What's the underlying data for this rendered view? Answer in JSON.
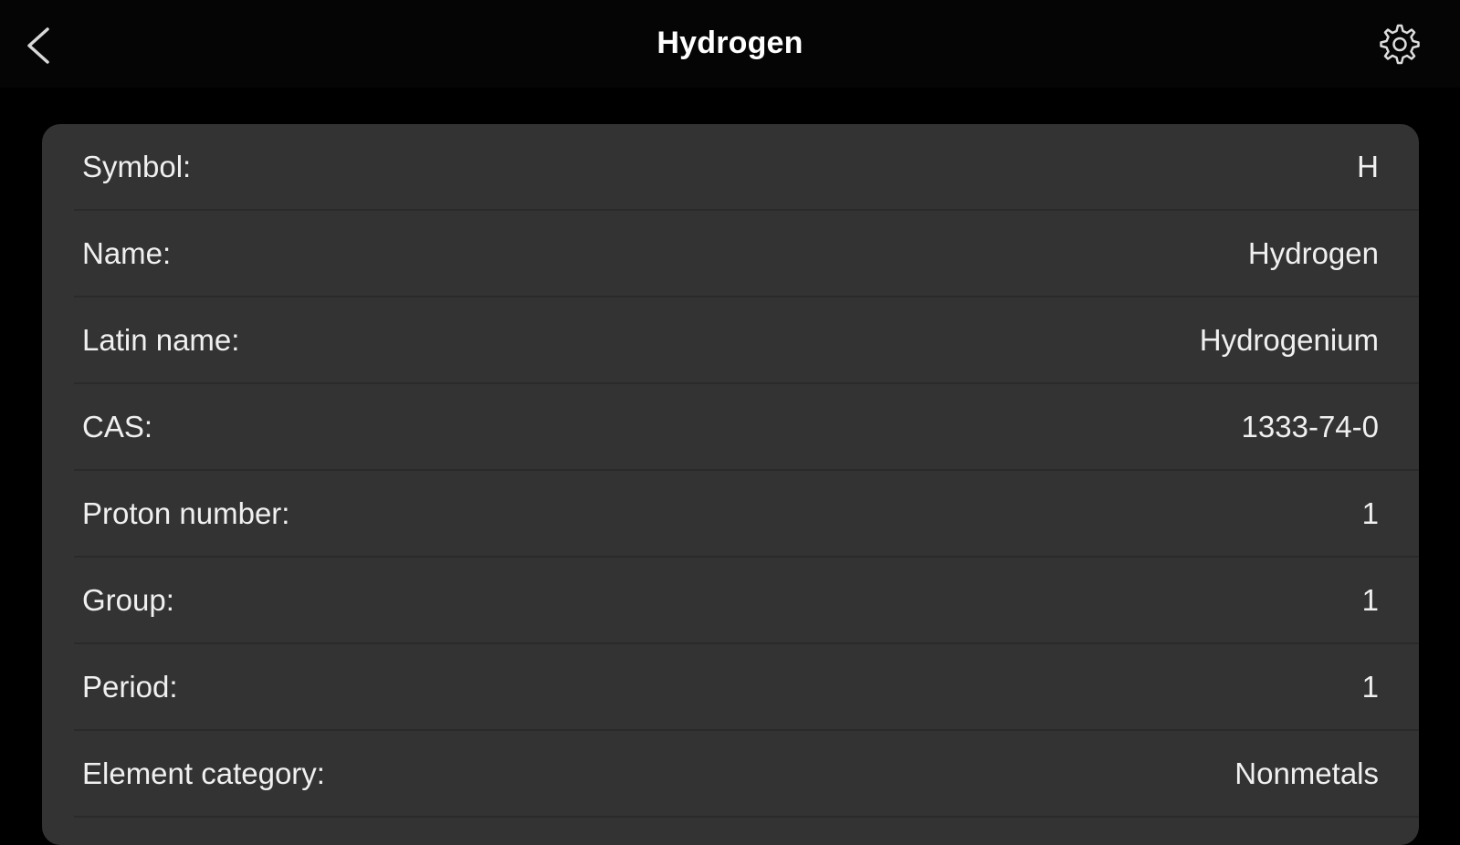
{
  "header": {
    "title": "Hydrogen",
    "back_icon": "chevron-left-icon",
    "settings_icon": "gear-icon"
  },
  "properties": [
    {
      "label": "Symbol:",
      "value": "H"
    },
    {
      "label": "Name:",
      "value": "Hydrogen"
    },
    {
      "label": "Latin name:",
      "value": "Hydrogenium"
    },
    {
      "label": "CAS:",
      "value": "1333-74-0"
    },
    {
      "label": "Proton number:",
      "value": "1"
    },
    {
      "label": "Group:",
      "value": "1"
    },
    {
      "label": "Period:",
      "value": "1"
    },
    {
      "label": "Element category:",
      "value": "Nonmetals"
    }
  ],
  "colors": {
    "background": "#000000",
    "card": "#333333",
    "text": "#f0f0f0"
  }
}
